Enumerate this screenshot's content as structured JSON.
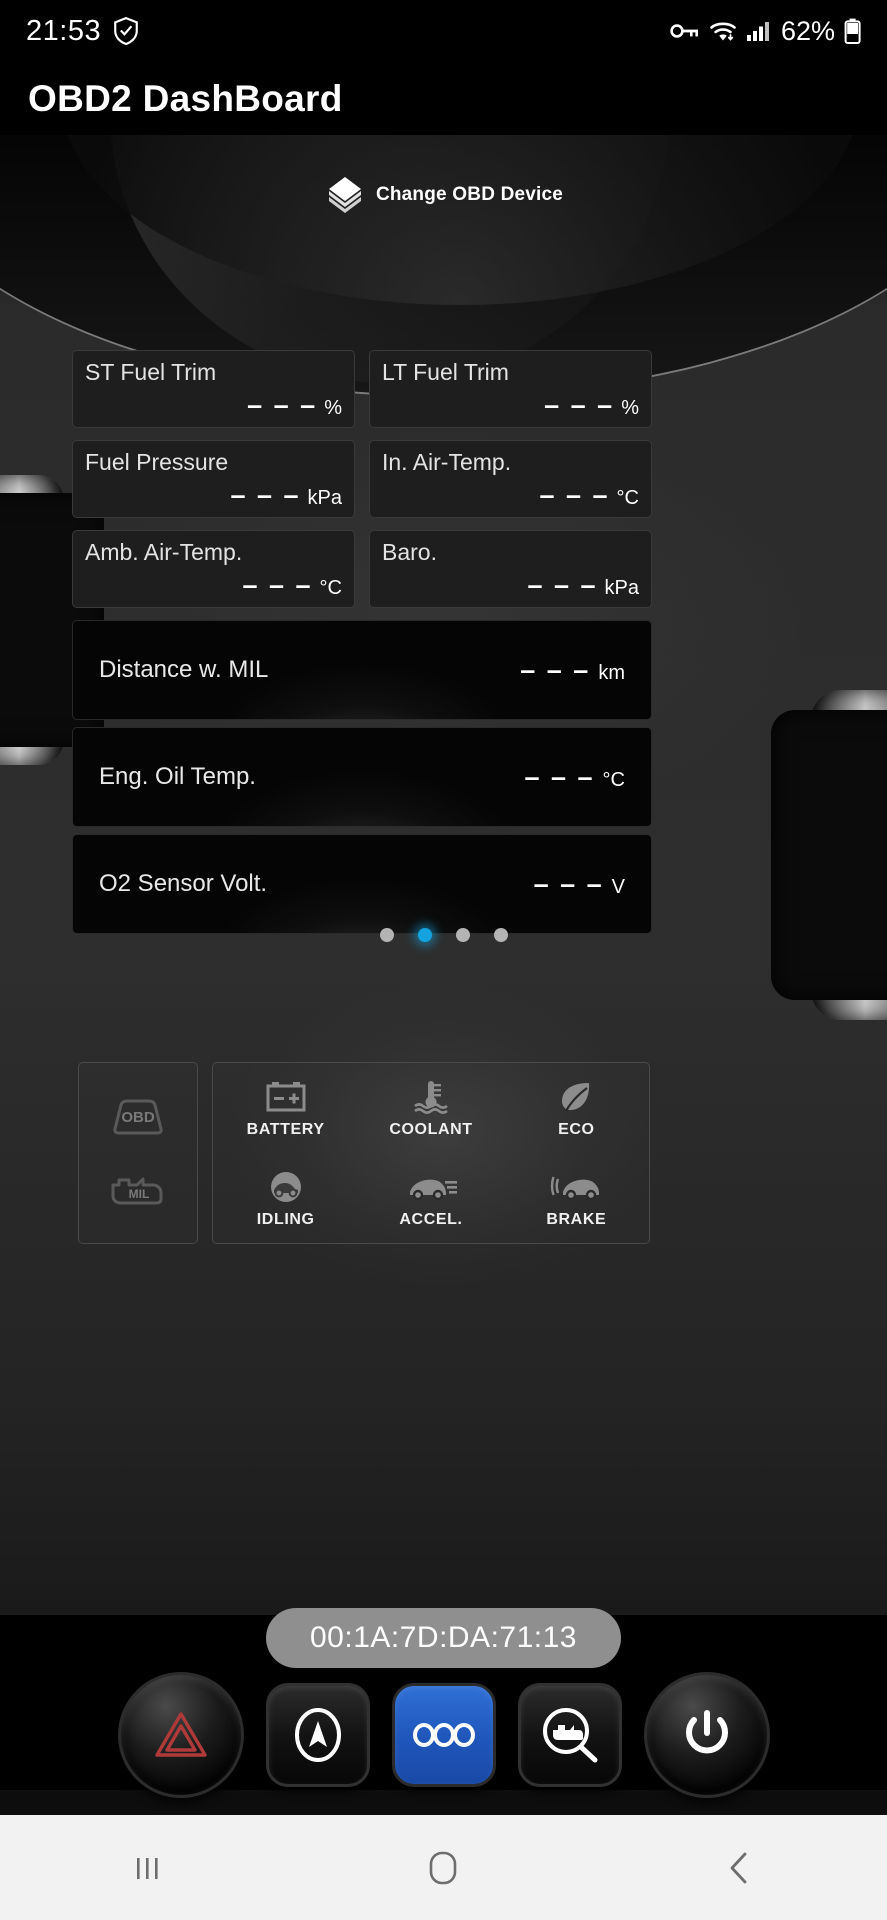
{
  "status_bar": {
    "time": "21:53",
    "shield_icon": "shield-check-icon",
    "vpn_icon": "key-icon",
    "wifi_icon": "wifi-icon",
    "signal_icon": "cellular-signal-icon",
    "battery_percent": "62%",
    "battery_icon": "battery-icon"
  },
  "app": {
    "title": "OBD2 DashBoard"
  },
  "change_device": {
    "label": "Change OBD Device",
    "icon": "obd-device-stack-icon"
  },
  "gauges": {
    "small_cards": [
      {
        "label": "ST Fuel Trim",
        "value": "– – –",
        "unit": "%"
      },
      {
        "label": "LT Fuel Trim",
        "value": "– – –",
        "unit": "%"
      },
      {
        "label": "Fuel Pressure",
        "value": "– – –",
        "unit": "kPa"
      },
      {
        "label": "In. Air-Temp.",
        "value": "– – –",
        "unit": "°C"
      },
      {
        "label": "Amb. Air-Temp.",
        "value": "– – –",
        "unit": "°C"
      },
      {
        "label": "Baro.",
        "value": "– – –",
        "unit": "kPa"
      }
    ],
    "wide_cards": [
      {
        "label": "Distance w. MIL",
        "value": "– – –",
        "unit": "km"
      },
      {
        "label": "Eng. Oil Temp.",
        "value": "– – –",
        "unit": "°C"
      },
      {
        "label": "O2 Sensor Volt.",
        "value": "– – –",
        "unit": "V"
      }
    ]
  },
  "pager": {
    "total": 4,
    "active_index": 1,
    "active_color": "#14a3e0",
    "inactive_color": "#b4b4b4"
  },
  "indicator_panel": {
    "left": [
      {
        "label": "OBD",
        "icon": "obd-plug-icon"
      },
      {
        "label": "MIL",
        "icon": "check-engine-mil-icon"
      }
    ],
    "grid": [
      {
        "label": "BATTERY",
        "icon": "battery-terminal-icon"
      },
      {
        "label": "COOLANT",
        "icon": "coolant-temp-icon"
      },
      {
        "label": "ECO",
        "icon": "eco-leaf-icon"
      },
      {
        "label": "IDLING",
        "icon": "idling-car-circle-icon"
      },
      {
        "label": "ACCEL.",
        "icon": "accelerating-car-icon"
      },
      {
        "label": "BRAKE",
        "icon": "braking-car-icon"
      }
    ]
  },
  "device": {
    "mac_address": "00:1A:7D:DA:71:13"
  },
  "controls": [
    {
      "name": "hazard-button",
      "icon": "hazard-triangle-icon",
      "style": "round",
      "active": false
    },
    {
      "name": "navigation-button",
      "icon": "navigation-arrow-icon",
      "style": "square",
      "active": false
    },
    {
      "name": "more-button",
      "icon": "three-dots-icon",
      "style": "square",
      "active": true
    },
    {
      "name": "diagnostics-button",
      "icon": "engine-scan-icon",
      "style": "square",
      "active": false
    },
    {
      "name": "power-button",
      "icon": "power-icon",
      "style": "round",
      "active": false
    }
  ],
  "android_nav": {
    "recents": "recents-icon",
    "home": "home-icon",
    "back": "back-icon"
  }
}
